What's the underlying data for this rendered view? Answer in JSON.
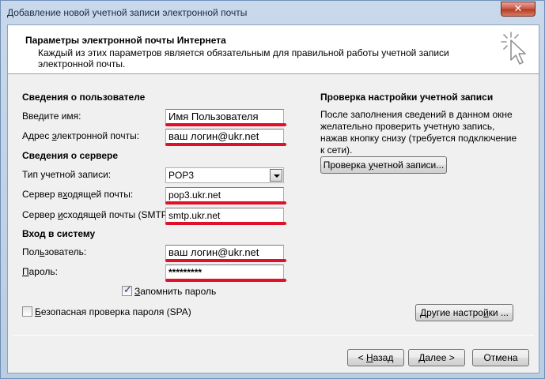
{
  "window": {
    "title": "Добавление новой учетной записи электронной почты",
    "close_label": "✕"
  },
  "header": {
    "title": "Параметры электронной почты Интернета",
    "description": "Каждый из этих параметров является обязательным для правильной работы учетной записи электронной почты."
  },
  "user_info": {
    "heading": "Сведения о пользователе",
    "name_label_pre": "Введите имя:",
    "name_value": "Имя Пользователя",
    "email_label_pre": "Адрес ",
    "email_label_u": "э",
    "email_label_post": "лектронной почты:",
    "email_value": "ваш логин@ukr.net"
  },
  "server_info": {
    "heading": "Сведения о сервере",
    "account_type_label": "Тип учетной записи:",
    "account_type_value": "POP3",
    "incoming_label_pre": "Сервер в",
    "incoming_label_u": "х",
    "incoming_label_post": "одящей почты:",
    "incoming_value": "pop3.ukr.net",
    "outgoing_label_pre": "Сервер ",
    "outgoing_label_u": "и",
    "outgoing_label_post": "сходящей почты (SMTP):",
    "outgoing_value": "smtp.ukr.net"
  },
  "logon": {
    "heading": "Вход в систему",
    "user_label_pre": "Пол",
    "user_label_u": "ь",
    "user_label_post": "зователь:",
    "user_value": "ваш логин@ukr.net",
    "password_label_pre": "",
    "password_label_u": "П",
    "password_label_post": "ароль:",
    "password_value": "*********",
    "remember_label_u": "З",
    "remember_label_post": "апомнить пароль",
    "remember_checked": true,
    "spa_label_u": "Б",
    "spa_label_post": "езопасная проверка пароля (SPA)",
    "spa_checked": false
  },
  "test_settings": {
    "heading": "Проверка настройки учетной записи",
    "description": "После заполнения сведений в данном окне желательно проверить учетную запись, нажав кнопку снизу (требуется подключение к сети).",
    "test_button_pre": "Проверка ",
    "test_button_u": "у",
    "test_button_post": "четной записи...",
    "more_settings_pre": "Другие настро",
    "more_settings_u": "й",
    "more_settings_post": "ки ..."
  },
  "footer": {
    "back_pre": "< ",
    "back_u": "Н",
    "back_post": "азад",
    "next_u": "Д",
    "next_post": "алее >",
    "cancel_label": "Отмена"
  },
  "colors": {
    "highlight_underline": "#e0102a"
  },
  "icons": {
    "header": "cursor-click-icon",
    "combo": "chevron-down-icon",
    "check": "checkmark-icon"
  }
}
